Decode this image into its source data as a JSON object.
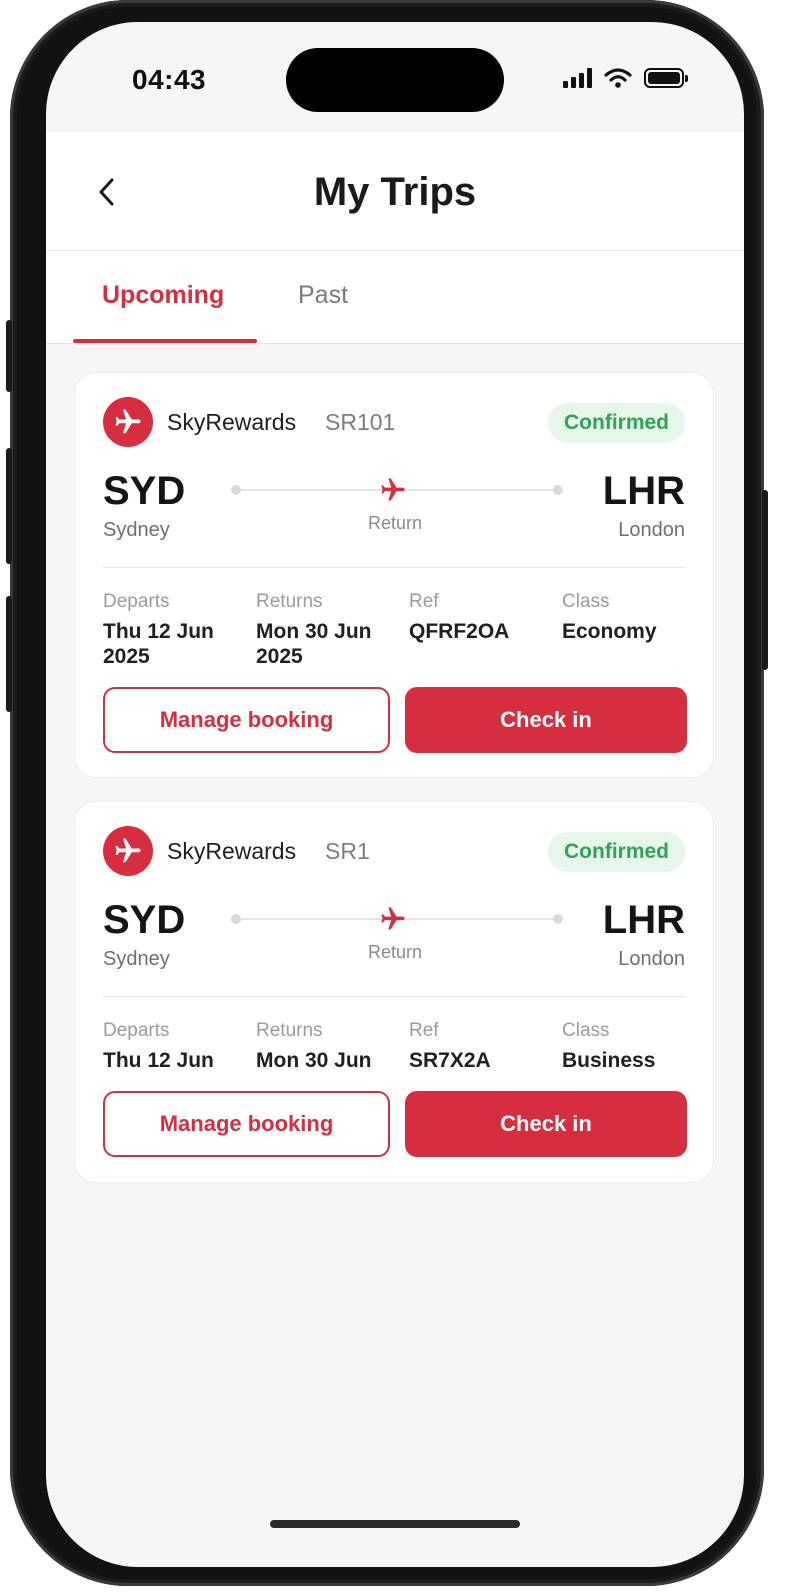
{
  "status": {
    "time": "04:43"
  },
  "header": {
    "title": "My Trips"
  },
  "tabs": [
    {
      "label": "Upcoming",
      "active": true
    },
    {
      "label": "Past",
      "active": false
    }
  ],
  "colors": {
    "accent": "#d72e3f",
    "confirmed_bg": "#e6f6ea",
    "confirmed_text": "#2fa356"
  },
  "trips": [
    {
      "airline": "SkyRewards",
      "flight": "SR101",
      "status": "Confirmed",
      "from_code": "SYD",
      "from_city": "Sydney",
      "to_code": "LHR",
      "to_city": "London",
      "trip_type": "Return",
      "departs_label": "Departs",
      "departs": "Thu 12 Jun 2025",
      "returns_label": "Returns",
      "returns": "Mon 30 Jun 2025",
      "ref_label": "Ref",
      "ref": "QFRF2OA",
      "class_label": "Class",
      "class": "Economy",
      "manage_label": "Manage booking",
      "checkin_label": "Check in"
    },
    {
      "airline": "SkyRewards",
      "flight": "SR1",
      "status": "Confirmed",
      "from_code": "SYD",
      "from_city": "Sydney",
      "to_code": "LHR",
      "to_city": "London",
      "trip_type": "Return",
      "departs_label": "Departs",
      "departs": "Thu 12 Jun",
      "returns_label": "Returns",
      "returns": "Mon 30 Jun",
      "ref_label": "Ref",
      "ref": "SR7X2A",
      "class_label": "Class",
      "class": "Business",
      "manage_label": "Manage booking",
      "checkin_label": "Check in"
    }
  ]
}
